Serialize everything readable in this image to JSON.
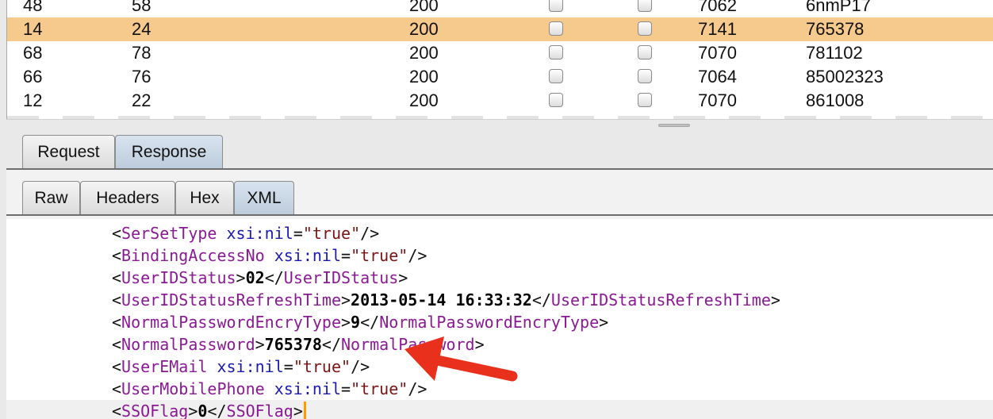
{
  "results_table": {
    "rows": [
      {
        "c0": "48",
        "c1": "58",
        "c2": "200",
        "c5": "7062",
        "c6": "6nmP17",
        "selected": false
      },
      {
        "c0": "14",
        "c1": "24",
        "c2": "200",
        "c5": "7141",
        "c6": "765378",
        "selected": true
      },
      {
        "c0": "68",
        "c1": "78",
        "c2": "200",
        "c5": "7070",
        "c6": "781102",
        "selected": false
      },
      {
        "c0": "66",
        "c1": "76",
        "c2": "200",
        "c5": "7064",
        "c6": "85002323",
        "selected": false
      },
      {
        "c0": "12",
        "c1": "22",
        "c2": "200",
        "c5": "7070",
        "c6": "861008",
        "selected": false
      }
    ],
    "selected_row_color": "#f6c98c"
  },
  "message_tabs": {
    "request": "Request",
    "response": "Response",
    "active": "Response"
  },
  "view_tabs": {
    "raw": "Raw",
    "headers": "Headers",
    "hex": "Hex",
    "xml": "XML",
    "active": "XML"
  },
  "xml_lines": [
    [
      {
        "k": "pt",
        "t": "<"
      },
      {
        "k": "tg",
        "t": "SerSetType"
      },
      {
        "k": "pt",
        "t": " "
      },
      {
        "k": "at",
        "t": "xsi:nil"
      },
      {
        "k": "pt",
        "t": "="
      },
      {
        "k": "av",
        "t": "\"true\""
      },
      {
        "k": "pt",
        "t": "/>"
      }
    ],
    [
      {
        "k": "pt",
        "t": "<"
      },
      {
        "k": "tg",
        "t": "BindingAccessNo"
      },
      {
        "k": "pt",
        "t": " "
      },
      {
        "k": "at",
        "t": "xsi:nil"
      },
      {
        "k": "pt",
        "t": "="
      },
      {
        "k": "av",
        "t": "\"true\""
      },
      {
        "k": "pt",
        "t": "/>"
      }
    ],
    [
      {
        "k": "pt",
        "t": "<"
      },
      {
        "k": "tg",
        "t": "UserIDStatus"
      },
      {
        "k": "pt",
        "t": ">"
      },
      {
        "k": "tx",
        "t": "02"
      },
      {
        "k": "pt",
        "t": "</"
      },
      {
        "k": "tg",
        "t": "UserIDStatus"
      },
      {
        "k": "pt",
        "t": ">"
      }
    ],
    [
      {
        "k": "pt",
        "t": "<"
      },
      {
        "k": "tg",
        "t": "UserIDStatusRefreshTime"
      },
      {
        "k": "pt",
        "t": ">"
      },
      {
        "k": "tx",
        "t": "2013-05-14 16:33:32"
      },
      {
        "k": "pt",
        "t": "</"
      },
      {
        "k": "tg",
        "t": "UserIDStatusRefreshTime"
      },
      {
        "k": "pt",
        "t": ">"
      }
    ],
    [
      {
        "k": "pt",
        "t": "<"
      },
      {
        "k": "tg",
        "t": "NormalPasswordEncryType"
      },
      {
        "k": "pt",
        "t": ">"
      },
      {
        "k": "tx",
        "t": "9"
      },
      {
        "k": "pt",
        "t": "</"
      },
      {
        "k": "tg",
        "t": "NormalPasswordEncryType"
      },
      {
        "k": "pt",
        "t": ">"
      }
    ],
    [
      {
        "k": "pt",
        "t": "<"
      },
      {
        "k": "tg",
        "t": "NormalPassword"
      },
      {
        "k": "pt",
        "t": ">"
      },
      {
        "k": "tx",
        "t": "765378"
      },
      {
        "k": "pt",
        "t": "</"
      },
      {
        "k": "tg",
        "t": "NormalPassword"
      },
      {
        "k": "pt",
        "t": ">"
      }
    ],
    [
      {
        "k": "pt",
        "t": "<"
      },
      {
        "k": "tg",
        "t": "UserEMail"
      },
      {
        "k": "pt",
        "t": " "
      },
      {
        "k": "at",
        "t": "xsi:nil"
      },
      {
        "k": "pt",
        "t": "="
      },
      {
        "k": "av",
        "t": "\"true\""
      },
      {
        "k": "pt",
        "t": "/>"
      }
    ],
    [
      {
        "k": "pt",
        "t": "<"
      },
      {
        "k": "tg",
        "t": "UserMobilePhone"
      },
      {
        "k": "pt",
        "t": " "
      },
      {
        "k": "at",
        "t": "xsi:nil"
      },
      {
        "k": "pt",
        "t": "="
      },
      {
        "k": "av",
        "t": "\"true\""
      },
      {
        "k": "pt",
        "t": "/>"
      }
    ],
    [
      {
        "k": "pt",
        "t": "<"
      },
      {
        "k": "tg",
        "t": "SSOFlag"
      },
      {
        "k": "pt",
        "t": ">"
      },
      {
        "k": "tx",
        "t": "0"
      },
      {
        "k": "pt",
        "t": "</"
      },
      {
        "k": "tg",
        "t": "SSOFlag"
      },
      {
        "k": "pt",
        "t": ">"
      }
    ]
  ],
  "annotation": {
    "shape": "arrow-icon",
    "color": "#e8301c"
  }
}
